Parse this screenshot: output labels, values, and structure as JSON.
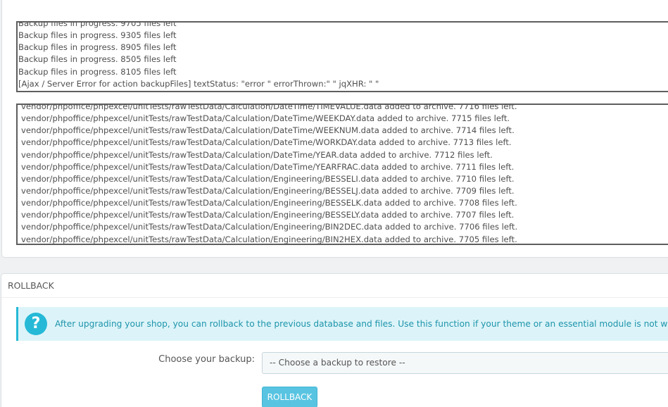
{
  "progress_log": [
    "Backup files in progress. 9705 files left",
    "Backup files in progress. 9305 files left",
    "Backup files in progress. 8905 files left",
    "Backup files in progress. 8505 files left",
    "Backup files in progress. 8105 files left",
    "[Ajax / Server Error for action backupFiles] textStatus: \"error \" errorThrown:\" \" jqXHR: \" \""
  ],
  "files_log": [
    "vendor/phpoffice/phpexcel/unitTests/rawTestData/Calculation/DateTime/TIMEVALUE.data added to archive. 7716 files left.",
    "vendor/phpoffice/phpexcel/unitTests/rawTestData/Calculation/DateTime/WEEKDAY.data added to archive. 7715 files left.",
    "vendor/phpoffice/phpexcel/unitTests/rawTestData/Calculation/DateTime/WEEKNUM.data added to archive. 7714 files left.",
    "vendor/phpoffice/phpexcel/unitTests/rawTestData/Calculation/DateTime/WORKDAY.data added to archive. 7713 files left.",
    "vendor/phpoffice/phpexcel/unitTests/rawTestData/Calculation/DateTime/YEAR.data added to archive. 7712 files left.",
    "vendor/phpoffice/phpexcel/unitTests/rawTestData/Calculation/DateTime/YEARFRAC.data added to archive. 7711 files left.",
    "vendor/phpoffice/phpexcel/unitTests/rawTestData/Calculation/Engineering/BESSELI.data added to archive. 7710 files left.",
    "vendor/phpoffice/phpexcel/unitTests/rawTestData/Calculation/Engineering/BESSELJ.data added to archive. 7709 files left.",
    "vendor/phpoffice/phpexcel/unitTests/rawTestData/Calculation/Engineering/BESSELK.data added to archive. 7708 files left.",
    "vendor/phpoffice/phpexcel/unitTests/rawTestData/Calculation/Engineering/BESSELY.data added to archive. 7707 files left.",
    "vendor/phpoffice/phpexcel/unitTests/rawTestData/Calculation/Engineering/BIN2DEC.data added to archive. 7706 files left.",
    "vendor/phpoffice/phpexcel/unitTests/rawTestData/Calculation/Engineering/BIN2HEX.data added to archive. 7705 files left."
  ],
  "rollback": {
    "heading": "ROLLBACK",
    "info_icon": "question-icon",
    "info_text": "After upgrading your shop, you can rollback to the previous database and files. Use this function if your theme or an essential module is not working correctly.",
    "backup_label": "Choose your backup:",
    "backup_selected": "-- Choose a backup to restore --",
    "button_label": "ROLLBACK"
  },
  "colors": {
    "accent": "#25b9d7",
    "button": "#59c4e1",
    "info_bg": "#dcf4f9",
    "info_text": "#1e94ab"
  }
}
